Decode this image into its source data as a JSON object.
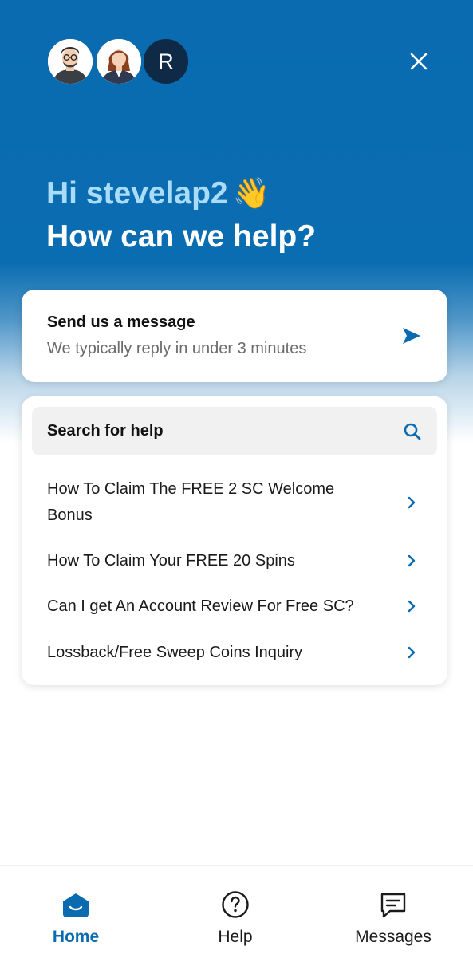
{
  "header": {
    "avatars": [
      {
        "type": "photo",
        "icon": "man-with-glasses-avatar"
      },
      {
        "type": "photo",
        "icon": "woman-avatar"
      },
      {
        "type": "initial",
        "initial": "R"
      }
    ],
    "close_icon": "close-icon",
    "greeting_line1": "Hi stevelap2",
    "wave_emoji": "👋",
    "greeting_line2": "How can we help?"
  },
  "message_card": {
    "title": "Send us a message",
    "subtitle": "We typically reply in under 3 minutes",
    "icon": "send-icon"
  },
  "help_card": {
    "search_label": "Search for help",
    "search_icon": "search-icon",
    "articles": [
      {
        "title": "How To Claim The FREE 2 SC Welcome Bonus"
      },
      {
        "title": "How To Claim Your FREE 20 Spins"
      },
      {
        "title": "Can I get An Account Review For Free SC?"
      },
      {
        "title": "Lossback/Free Sweep Coins Inquiry"
      }
    ]
  },
  "bottom_nav": {
    "items": [
      {
        "label": "Home",
        "icon": "home-icon",
        "active": true
      },
      {
        "label": "Help",
        "icon": "help-icon",
        "active": false
      },
      {
        "label": "Messages",
        "icon": "messages-icon",
        "active": false
      }
    ]
  },
  "colors": {
    "brand_blue": "#0a6bb0",
    "greeting_light": "#a9dcf8",
    "avatar_dark": "#0e2a47",
    "search_bg": "#f1f1f1",
    "muted_text": "#6b6b6b"
  }
}
